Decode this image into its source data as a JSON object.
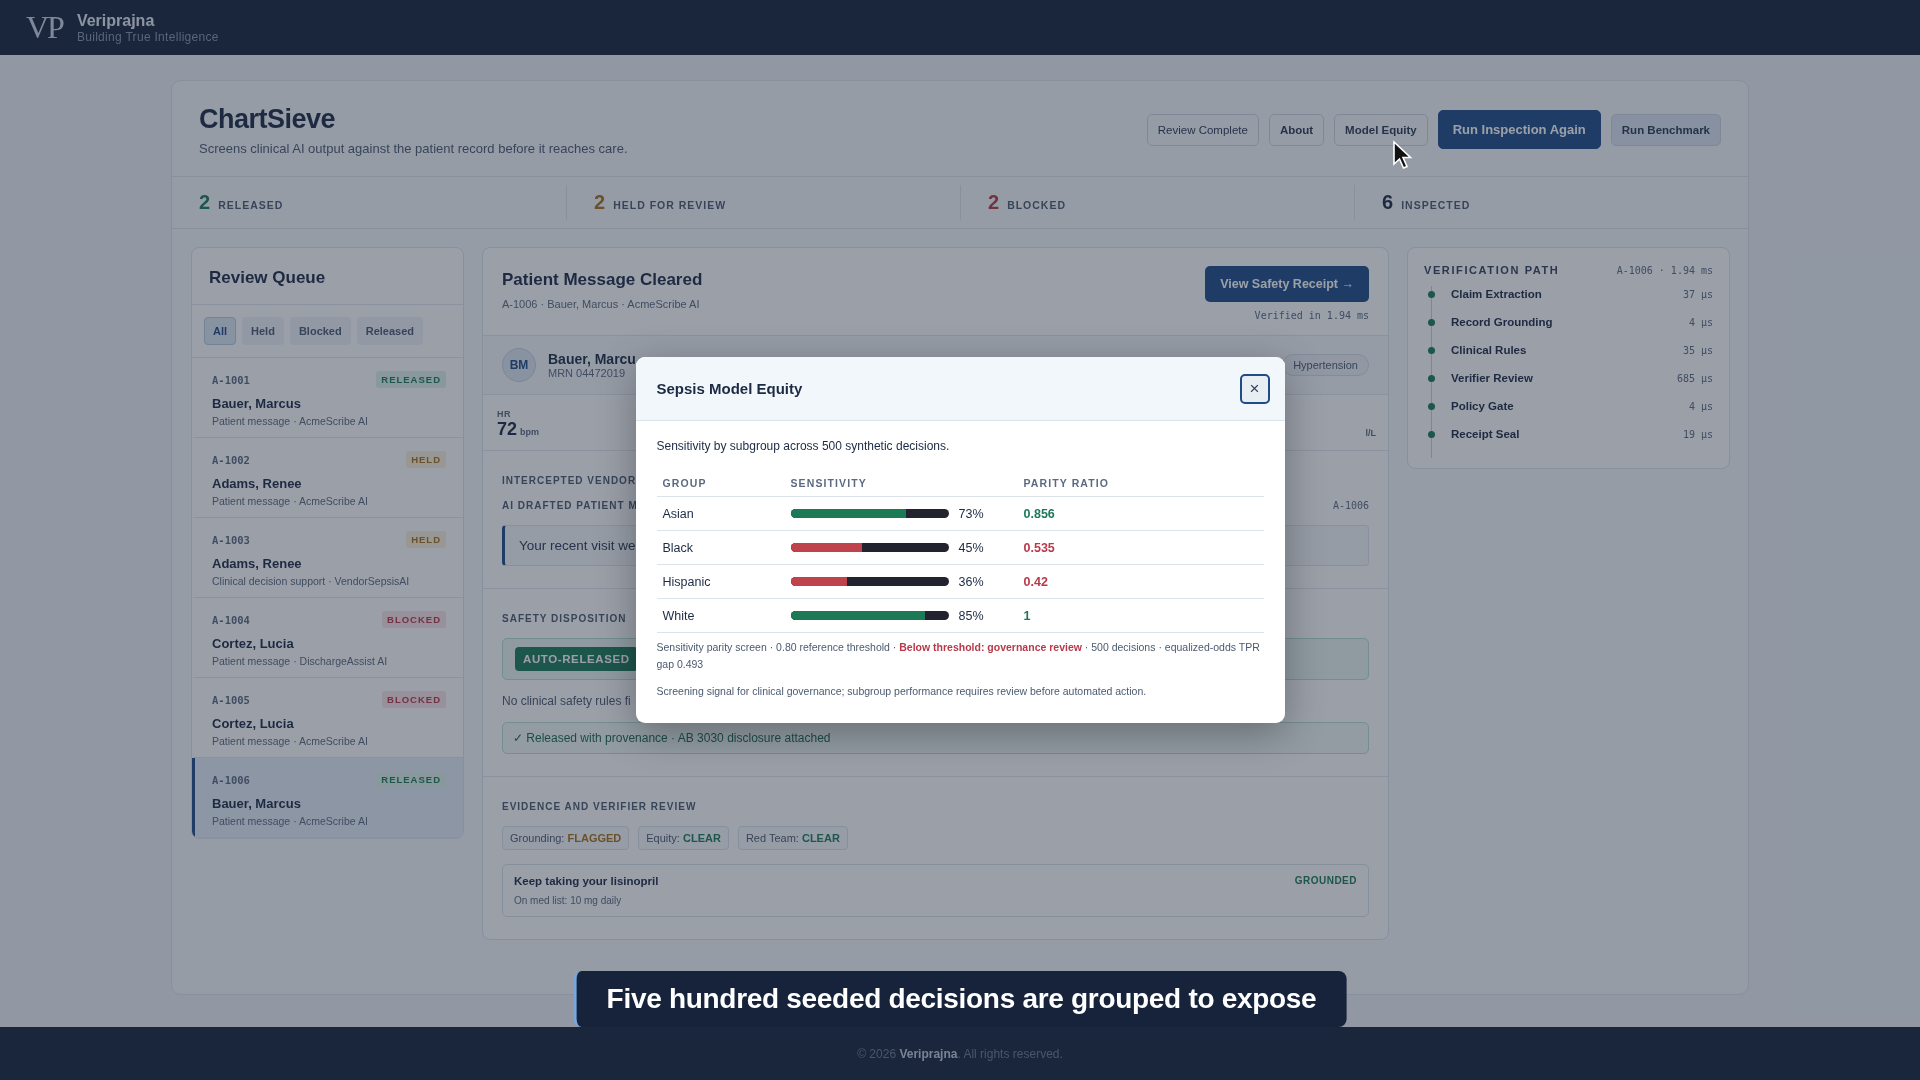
{
  "brand": {
    "logo": "VP",
    "name": "Veriprajna",
    "tagline": "Building True Intelligence"
  },
  "app": {
    "title": "ChartSieve",
    "subtitle": "Screens clinical AI output against the patient record before it reaches care.",
    "buttons": [
      {
        "label": "Review Complete",
        "kind": "outline"
      },
      {
        "label": "About",
        "kind": "outline"
      },
      {
        "label": "Model Equity",
        "kind": "outline"
      },
      {
        "label": "Run Inspection Again",
        "kind": "primary"
      },
      {
        "label": "Run Benchmark",
        "kind": "secondary"
      }
    ]
  },
  "stats": [
    {
      "value": "2",
      "label": "RELEASED",
      "kind": "released"
    },
    {
      "value": "2",
      "label": "HELD FOR REVIEW",
      "kind": "held"
    },
    {
      "value": "2",
      "label": "BLOCKED",
      "kind": "blocked"
    },
    {
      "value": "6",
      "label": "INSPECTED",
      "kind": "total"
    }
  ],
  "queue": {
    "title": "Review Queue",
    "filters": [
      {
        "label": "All",
        "selected": true
      },
      {
        "label": "Held",
        "selected": false
      },
      {
        "label": "Blocked",
        "selected": false
      },
      {
        "label": "Released",
        "selected": false
      }
    ],
    "items": [
      {
        "id": "A-1001",
        "status": "RELEASED",
        "kind": "released",
        "name": "Bauer, Marcus",
        "meta": "Patient message · AcmeScribe AI",
        "selected": false
      },
      {
        "id": "A-1002",
        "status": "HELD",
        "kind": "held",
        "name": "Adams, Renee",
        "meta": "Patient message · AcmeScribe AI",
        "selected": false
      },
      {
        "id": "A-1003",
        "status": "HELD",
        "kind": "held",
        "name": "Adams, Renee",
        "meta": "Clinical decision support · VendorSepsisAI",
        "selected": false
      },
      {
        "id": "A-1004",
        "status": "BLOCKED",
        "kind": "blocked",
        "name": "Cortez, Lucia",
        "meta": "Patient message · DischargeAssist AI",
        "selected": false
      },
      {
        "id": "A-1005",
        "status": "BLOCKED",
        "kind": "blocked",
        "name": "Cortez, Lucia",
        "meta": "Patient message · AcmeScribe AI",
        "selected": false
      },
      {
        "id": "A-1006",
        "status": "RELEASED",
        "kind": "released",
        "name": "Bauer, Marcus",
        "meta": "Patient message · AcmeScribe AI",
        "selected": true
      }
    ]
  },
  "detail": {
    "title": "Patient Message Cleared",
    "subtitle": "A-1006 · Bauer, Marcus · AcmeScribe AI",
    "action": "View Safety Receipt →",
    "verified": "Verified in 1.94 ms",
    "patient": {
      "initials": "BM",
      "name": "Bauer, Marcu",
      "mrn": "MRN 04472019",
      "condition": "Hypertension"
    },
    "vitals": [
      {
        "label": "HR",
        "value": "72",
        "unit": "bpm"
      },
      {
        "unit": "l/L"
      }
    ],
    "intercepted_label": "INTERCEPTED VENDOR",
    "drafted_label": "AI DRAFTED PATIENT M",
    "drafted_id": "A-1006",
    "message": "Your recent visit we",
    "disposition_label": "SAFETY DISPOSITION",
    "disposition_badge": "AUTO-RELEASED",
    "disposition_note": "No clinical safety rules fi",
    "provenance": "✓ Released with provenance · AB 3030 disclosure attached",
    "evidence_label": "EVIDENCE AND VERIFIER REVIEW",
    "chips": [
      {
        "label": "Grounding:",
        "value": "FLAGGED",
        "kind": "flagged"
      },
      {
        "label": "Equity:",
        "value": "CLEAR",
        "kind": "clear"
      },
      {
        "label": "Red Team:",
        "value": "CLEAR",
        "kind": "clear"
      }
    ],
    "claim": {
      "text": "Keep taking your lisinopril",
      "source": "On med list: 10 mg daily",
      "status": "GROUNDED"
    }
  },
  "verification": {
    "title": "VERIFICATION PATH",
    "meta": "A-1006 · 1.94 ms",
    "steps": [
      {
        "name": "Claim Extraction",
        "time": "37 µs"
      },
      {
        "name": "Record Grounding",
        "time": "4 µs"
      },
      {
        "name": "Clinical Rules",
        "time": "35 µs"
      },
      {
        "name": "Verifier Review",
        "time": "685 µs"
      },
      {
        "name": "Policy Gate",
        "time": "4 µs"
      },
      {
        "name": "Receipt Seal",
        "time": "19 µs"
      }
    ]
  },
  "modal": {
    "title": "Sepsis Model Equity",
    "close": "×",
    "intro": "Sensitivity by subgroup across 500 synthetic decisions.",
    "columns": [
      "GROUP",
      "SENSITIVITY",
      "PARITY RATIO"
    ],
    "rows": [
      {
        "group": "Asian",
        "level": 0.73,
        "reading": "73%",
        "ratio": "0.856",
        "kind": "pass"
      },
      {
        "group": "Black",
        "level": 0.45,
        "reading": "45%",
        "ratio": "0.535",
        "kind": "fail"
      },
      {
        "group": "Hispanic",
        "level": 0.36,
        "reading": "36%",
        "ratio": "0.42",
        "kind": "fail"
      },
      {
        "group": "White",
        "level": 0.85,
        "reading": "85%",
        "ratio": "1",
        "kind": "pass"
      }
    ],
    "note": "Sensitivity parity screen · 0.80 reference threshold · **Below threshold: governance review** · 500 decisions · equalized-odds TPR gap 0.493",
    "disclaimer": "Screening signal for clinical governance; subgroup performance requires review before automated action."
  },
  "caption": "Five hundred seeded decisions are grouped to expose",
  "footer": "© 2026 **Veriprajna**. All rights reserved."
}
